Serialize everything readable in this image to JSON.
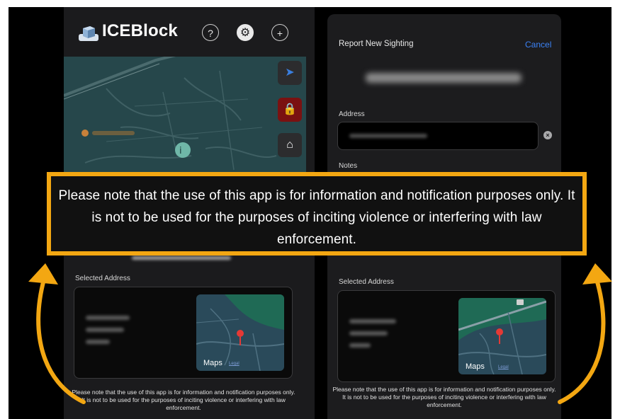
{
  "left_screen": {
    "app_title": "ICEBlock",
    "header_icons": [
      "question-circle-icon",
      "gear-icon",
      "plus-circle-icon"
    ],
    "map_controls": [
      "location-arrow-icon",
      "lock-icon",
      "home-icon"
    ],
    "selected_address_label": "Selected Address",
    "maps_brand": "Maps",
    "legal_link": "Legal",
    "disclaimer": "Please note that the use of this app is for information and notification purposes only. It is not to be used for the purposes of inciting violence or interfering with law enforcement."
  },
  "right_screen": {
    "sheet_title": "Report New Sighting",
    "cancel_label": "Cancel",
    "address_label": "Address",
    "notes_label": "Notes",
    "selected_address_label": "Selected Address",
    "maps_brand": "Maps",
    "legal_link": "Legal",
    "disclaimer": "Please note that the use of this app is for information and notification purposes only. It is not to be used for the purposes of inciting violence or interfering with law enforcement."
  },
  "overlay": {
    "notice": "Please note that the use of this app is for information and notification purposes only. It is not to be used for the purposes of inciting violence or interfering with law enforcement.",
    "border_color": "#f3a712",
    "arrow_color": "#f3a712"
  },
  "colors": {
    "background": "#000000",
    "accent_blue": "#3b82f6",
    "lock_red": "#7a1111",
    "map_green": "#26474b"
  }
}
